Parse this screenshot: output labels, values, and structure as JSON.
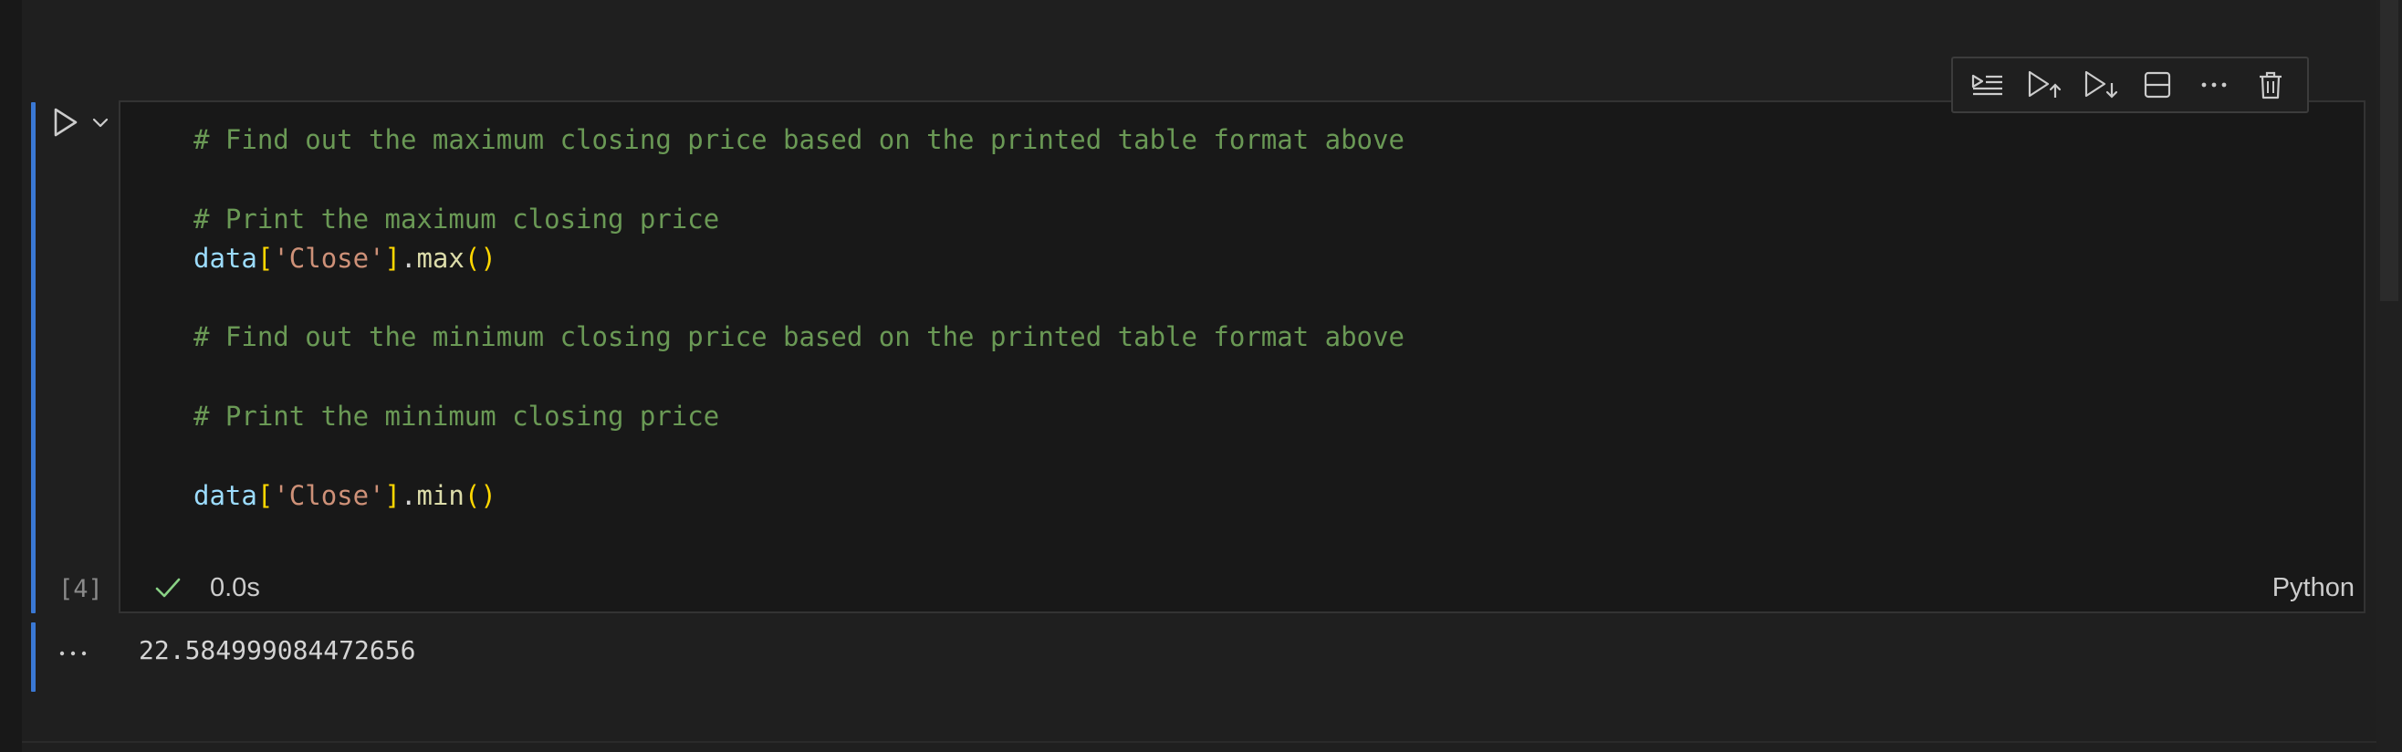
{
  "toolbar": {
    "icons": [
      "run-by-line-icon",
      "execute-above-icon",
      "execute-below-icon",
      "split-cell-icon",
      "more-actions-icon",
      "delete-icon"
    ]
  },
  "cell": {
    "execution_count": "[4]",
    "status_time": "0.0s",
    "language": "Python",
    "lines": [
      {
        "tokens": [
          {
            "t": "# Find out the maximum closing price based on the printed table format above",
            "c": "comment"
          }
        ]
      },
      {
        "tokens": []
      },
      {
        "tokens": [
          {
            "t": "# Print the maximum closing price",
            "c": "comment"
          }
        ]
      },
      {
        "tokens": [
          {
            "t": "data",
            "c": "var"
          },
          {
            "t": "[",
            "c": "bracket"
          },
          {
            "t": "'Close'",
            "c": "string"
          },
          {
            "t": "]",
            "c": "bracket"
          },
          {
            "t": ".",
            "c": "punc"
          },
          {
            "t": "max",
            "c": "method"
          },
          {
            "t": "()",
            "c": "bracket"
          }
        ]
      },
      {
        "tokens": []
      },
      {
        "tokens": [
          {
            "t": "# Find out the minimum closing price based on the printed table format above",
            "c": "comment"
          }
        ]
      },
      {
        "tokens": []
      },
      {
        "tokens": [
          {
            "t": "# Print the minimum closing price",
            "c": "comment"
          }
        ]
      },
      {
        "tokens": []
      },
      {
        "tokens": [
          {
            "t": "data",
            "c": "var"
          },
          {
            "t": "[",
            "c": "bracket"
          },
          {
            "t": "'Close'",
            "c": "string"
          },
          {
            "t": "]",
            "c": "bracket"
          },
          {
            "t": ".",
            "c": "punc"
          },
          {
            "t": "min",
            "c": "method"
          },
          {
            "t": "()",
            "c": "bracket"
          }
        ]
      }
    ]
  },
  "output": {
    "text": "22.584999084472656"
  },
  "colors": {
    "accent": "#3a78d4",
    "check": "#89d185",
    "comment": "#6a9955"
  }
}
